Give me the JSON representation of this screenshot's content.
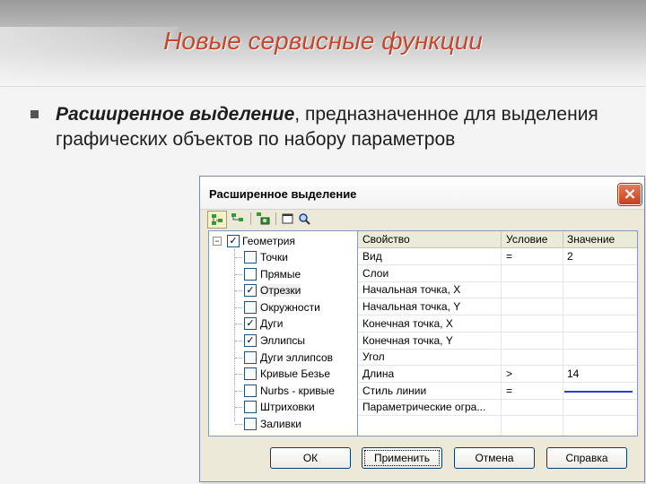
{
  "slide": {
    "title": "Новые сервисные функции",
    "bullet_term": "Расширенное выделение",
    "bullet_rest": ", предназначенное для выделения графических объектов по набору параметров"
  },
  "dialog": {
    "title": "Расширенное выделение",
    "close_icon": "close-icon",
    "toolbar_icons": [
      "tree-select-icon",
      "tree-expand-icon",
      "filter-image-icon",
      "window-icon",
      "zoom-icon"
    ],
    "tree": {
      "root": {
        "label": "Геометрия",
        "checked": true,
        "expander": "−"
      },
      "items": [
        {
          "label": "Точки",
          "checked": false
        },
        {
          "label": "Прямые",
          "checked": false
        },
        {
          "label": "Отрезки",
          "checked": true
        },
        {
          "label": "Окружности",
          "checked": false
        },
        {
          "label": "Дуги",
          "checked": true
        },
        {
          "label": "Эллипсы",
          "checked": true
        },
        {
          "label": "Дуги эллипсов",
          "checked": false
        },
        {
          "label": "Кривые Безье",
          "checked": false
        },
        {
          "label": "Nurbs - кривые",
          "checked": false
        },
        {
          "label": "Штриховки",
          "checked": false
        },
        {
          "label": "Заливки",
          "checked": false
        }
      ]
    },
    "grid": {
      "headers": [
        "Свойство",
        "Условие",
        "Значение"
      ],
      "rows": [
        {
          "property": "Вид",
          "condition": "=",
          "value": "2"
        },
        {
          "property": "Слои",
          "condition": "",
          "value": ""
        },
        {
          "property": "Начальная точка, X",
          "condition": "",
          "value": ""
        },
        {
          "property": "Начальная точка, Y",
          "condition": "",
          "value": ""
        },
        {
          "property": "Конечная точка, X",
          "condition": "",
          "value": ""
        },
        {
          "property": "Конечная точка, Y",
          "condition": "",
          "value": ""
        },
        {
          "property": "Угол",
          "condition": "",
          "value": ""
        },
        {
          "property": "Длина",
          "condition": ">",
          "value": "14"
        },
        {
          "property": "Стиль линии",
          "condition": "=",
          "value": ""
        },
        {
          "property": "Параметрические огра...",
          "condition": "",
          "value": ""
        }
      ],
      "line_style_color": "#2a3ec8"
    },
    "buttons": {
      "ok": "ОК",
      "apply": "Применить",
      "cancel": "Отмена",
      "help": "Справка"
    }
  }
}
